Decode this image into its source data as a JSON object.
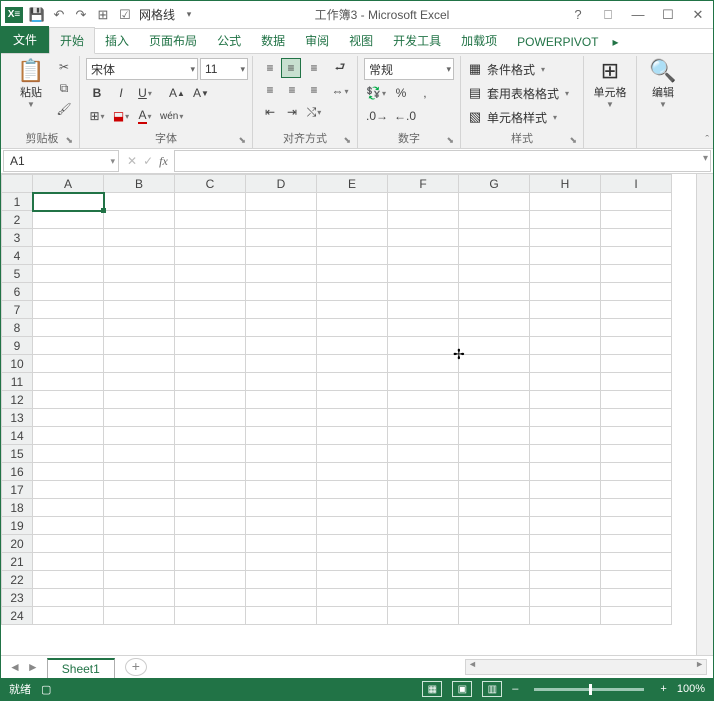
{
  "title": "工作簿3 - Microsoft Excel",
  "qat": {
    "gridlines_label": "网格线"
  },
  "tabs": {
    "file": "文件",
    "home": "开始",
    "insert": "插入",
    "layout": "页面布局",
    "formulas": "公式",
    "data": "数据",
    "review": "审阅",
    "view": "视图",
    "dev": "开发工具",
    "addins": "加载项",
    "powerpivot": "POWERPIVOT"
  },
  "clipboard": {
    "paste": "粘贴",
    "group": "剪贴板"
  },
  "font": {
    "name": "宋体",
    "size": "11",
    "group": "字体"
  },
  "align": {
    "group": "对齐方式"
  },
  "number": {
    "format": "常规",
    "group": "数字"
  },
  "styles": {
    "cond": "条件格式",
    "table": "套用表格格式",
    "cell": "单元格样式",
    "group": "样式"
  },
  "cells": {
    "label": "单元格"
  },
  "editing": {
    "label": "编辑"
  },
  "namebox": "A1",
  "columns": [
    "A",
    "B",
    "C",
    "D",
    "E",
    "F",
    "G",
    "H",
    "I"
  ],
  "rows": [
    "1",
    "2",
    "3",
    "4",
    "5",
    "6",
    "7",
    "8",
    "9",
    "10",
    "11",
    "12",
    "13",
    "14",
    "15",
    "16",
    "17",
    "18",
    "19",
    "20",
    "21",
    "22",
    "23",
    "24"
  ],
  "sheet": {
    "name": "Sheet1"
  },
  "status": {
    "ready": "就绪",
    "zoom": "100%"
  }
}
